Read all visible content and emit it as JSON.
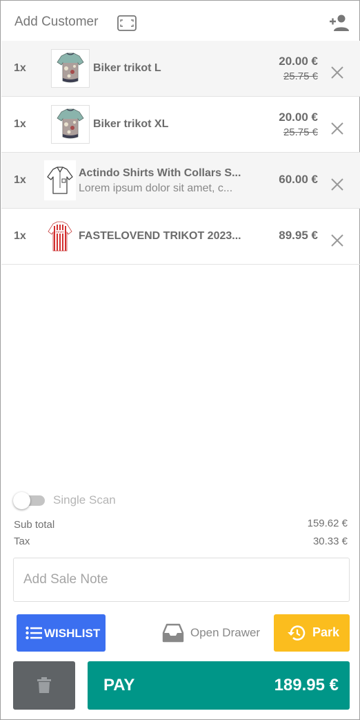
{
  "header": {
    "add_customer_label": "Add Customer",
    "scan_icon": "barcode-scan-frame",
    "add_customer_icon": "person-add"
  },
  "cart": {
    "items": [
      {
        "qty": "1x",
        "name": "Biker trikot L",
        "description": "",
        "price": "20.00 €",
        "original_price": "25.75 €",
        "thumbnail": "floral-jersey"
      },
      {
        "qty": "1x",
        "name": "Biker trikot XL",
        "description": "",
        "price": "20.00 €",
        "original_price": "25.75 €",
        "thumbnail": "floral-jersey"
      },
      {
        "qty": "1x",
        "name": "Actindo Shirts With Collars S...",
        "description": "Lorem ipsum dolor sit amet, c...",
        "price": "60.00 €",
        "original_price": "",
        "thumbnail": "shirt-outline"
      },
      {
        "qty": "1x",
        "name": "FASTELOVEND TRIKOT 2023...",
        "description": "",
        "price": "89.95 €",
        "original_price": "",
        "thumbnail": "red-white-striped-jersey"
      }
    ]
  },
  "single_scan": {
    "label": "Single Scan",
    "enabled": false
  },
  "totals": {
    "subtotal_label": "Sub total",
    "subtotal_value": "159.62 €",
    "tax_label": "Tax",
    "tax_value": "30.33 €"
  },
  "sale_note": {
    "placeholder": "Add Sale Note",
    "value": ""
  },
  "actions": {
    "wishlist_label": "WISHLIST",
    "open_drawer_label": "Open Drawer",
    "park_label": "Park",
    "pay_label": "PAY",
    "pay_amount": "189.95 €"
  },
  "colors": {
    "wishlist": "#3b6ff0",
    "park": "#fbbd1e",
    "pay": "#009688",
    "delete": "#5f6366"
  }
}
